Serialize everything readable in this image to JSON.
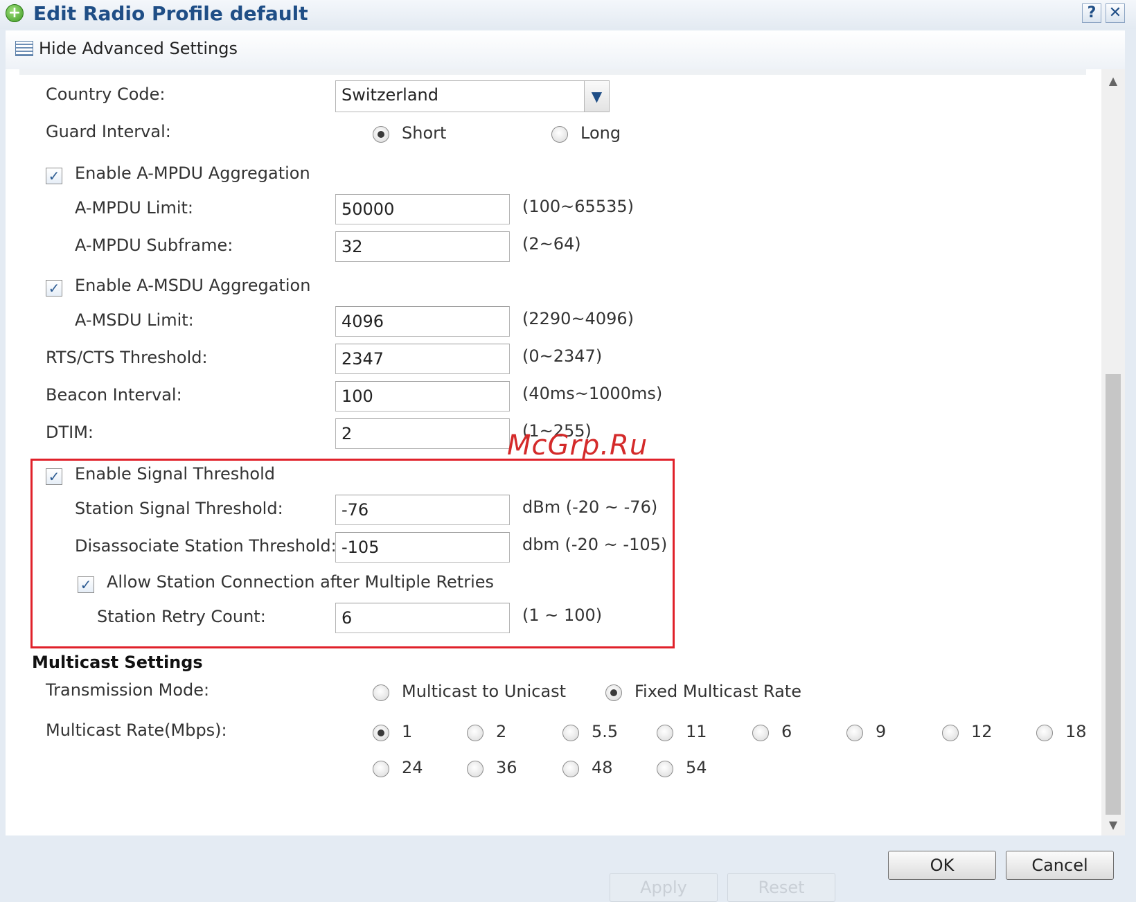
{
  "window": {
    "title": "Edit Radio Profile default",
    "help_label": "?",
    "close_label": "✕"
  },
  "toolbar": {
    "hide_advanced_label": "Hide Advanced Settings"
  },
  "form": {
    "country_code": {
      "label": "Country Code:",
      "value": "Switzerland"
    },
    "guard_interval": {
      "label": "Guard Interval:",
      "options": [
        {
          "label": "Short",
          "selected": true
        },
        {
          "label": "Long",
          "selected": false
        }
      ]
    },
    "ampdu": {
      "enable_label": "Enable A-MPDU Aggregation",
      "checked": true,
      "limit": {
        "label": "A-MPDU Limit:",
        "value": "50000",
        "range": "(100~65535)"
      },
      "subframe": {
        "label": "A-MPDU Subframe:",
        "value": "32",
        "range": "(2~64)"
      }
    },
    "amsdu": {
      "enable_label": "Enable A-MSDU Aggregation",
      "checked": true,
      "limit": {
        "label": "A-MSDU Limit:",
        "value": "4096",
        "range": "(2290~4096)"
      }
    },
    "rts_cts": {
      "label": "RTS/CTS Threshold:",
      "value": "2347",
      "range": "(0~2347)"
    },
    "beacon": {
      "label": "Beacon Interval:",
      "value": "100",
      "range": "(40ms~1000ms)"
    },
    "dtim": {
      "label": "DTIM:",
      "value": "2",
      "range": "(1~255)"
    },
    "signal_threshold": {
      "enable_label": "Enable Signal Threshold",
      "checked": true,
      "station_signal": {
        "label": "Station Signal Threshold:",
        "value": "-76",
        "range": "dBm (-20 ~ -76)"
      },
      "disassociate": {
        "label": "Disassociate Station Threshold:",
        "value": "-105",
        "range": "dbm (-20 ~ -105)"
      },
      "allow_retry": {
        "label": "Allow Station Connection after Multiple Retries",
        "checked": true
      },
      "retry_count": {
        "label": "Station Retry Count:",
        "value": "6",
        "range": "(1 ~ 100)"
      }
    }
  },
  "multicast": {
    "section_title": "Multicast Settings",
    "transmission_mode": {
      "label": "Transmission Mode:",
      "options": [
        {
          "label": "Multicast to Unicast",
          "selected": false
        },
        {
          "label": "Fixed Multicast Rate",
          "selected": true
        }
      ]
    },
    "rate": {
      "label": "Multicast Rate(Mbps):",
      "options": [
        "1",
        "2",
        "5.5",
        "11",
        "6",
        "9",
        "12",
        "18",
        "24",
        "36",
        "48",
        "54"
      ],
      "selected": "1"
    }
  },
  "watermark": "McGrp.Ru",
  "buttons": {
    "ok": "OK",
    "cancel": "Cancel",
    "apply": "Apply",
    "reset": "Reset"
  }
}
